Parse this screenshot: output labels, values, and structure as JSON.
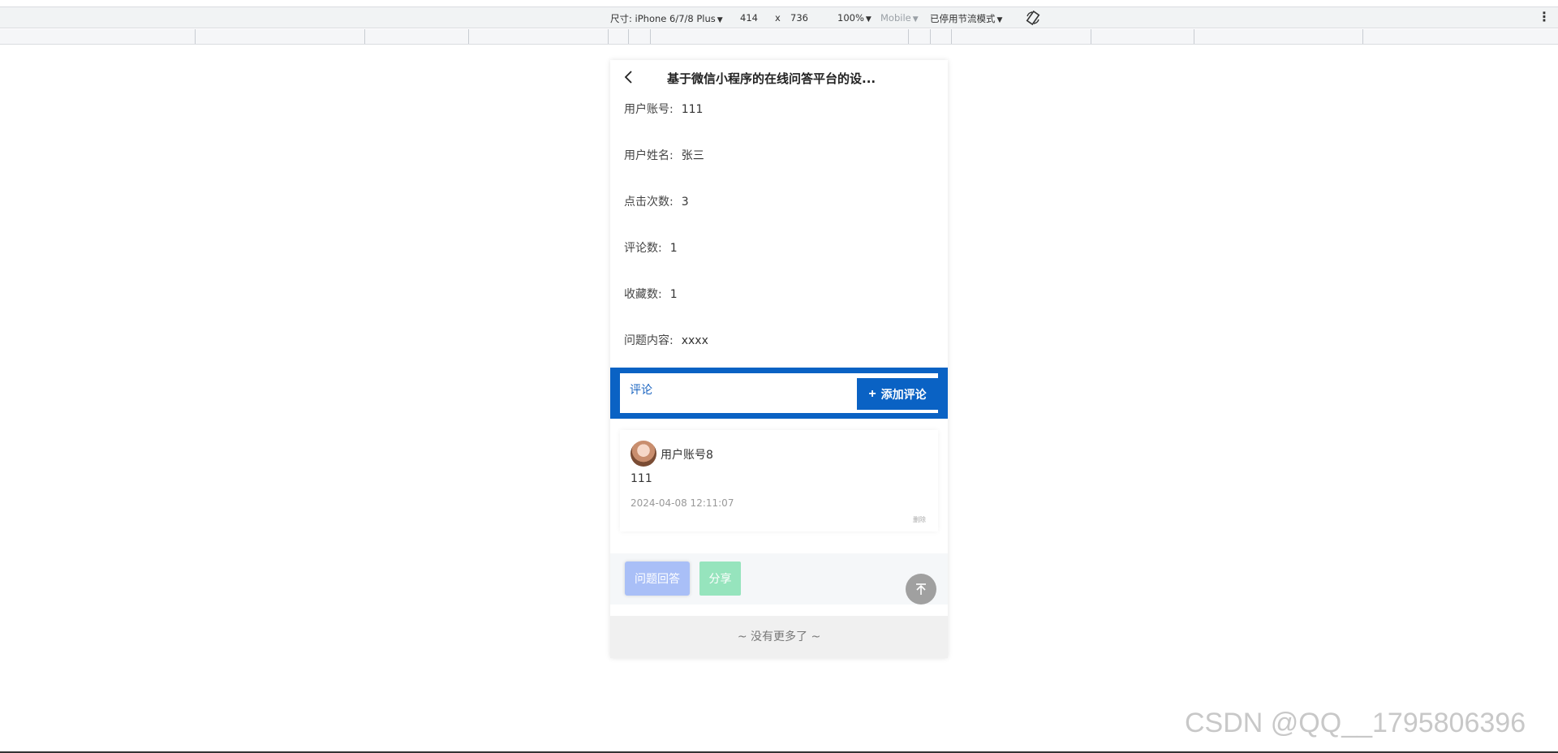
{
  "devtools": {
    "device_label": "尺寸: iPhone 6/7/8 Plus",
    "width": "414",
    "times": "x",
    "height": "736",
    "zoom": "100%",
    "mode": "Mobile",
    "throttle": "已停用节流模式"
  },
  "nav": {
    "title": "基于微信小程序的在线问答平台的设..."
  },
  "info": [
    {
      "label": "用户账号:",
      "value": "111"
    },
    {
      "label": "用户姓名:",
      "value": "张三"
    },
    {
      "label": "点击次数:",
      "value": "3"
    },
    {
      "label": "评论数:",
      "value": "1"
    },
    {
      "label": "收藏数:",
      "value": "1"
    },
    {
      "label": "问题内容:",
      "value": "xxxx"
    }
  ],
  "comments_section": {
    "tab_label": "评论",
    "add_label": "添加评论"
  },
  "comment": {
    "user": "用户账号8",
    "content": "111",
    "time": "2024-04-08 12:11:07",
    "delete_label": "删除"
  },
  "actions": {
    "answer_label": "问题回答",
    "share_label": "分享"
  },
  "footer": {
    "text": "~ 没有更多了 ~"
  },
  "watermark": "CSDN @QQ__1795806396"
}
